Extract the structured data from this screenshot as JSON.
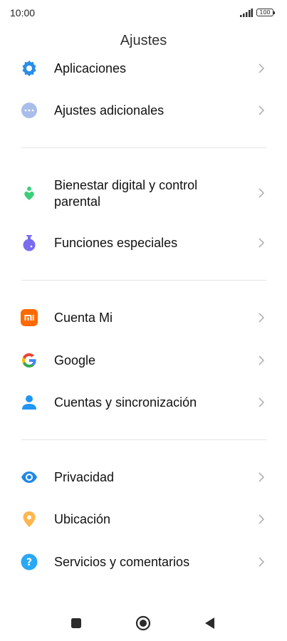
{
  "status_bar": {
    "time": "10:00",
    "battery": "100",
    "signal_icon": "signal-icon"
  },
  "header": {
    "title": "Ajustes"
  },
  "items": [
    {
      "id": "aplicaciones",
      "label": "Aplicaciones",
      "icon": "gear-badge-icon",
      "color": "#2a8ee8"
    },
    {
      "id": "ajustes-adicionales",
      "label": "Ajustes adicionales",
      "icon": "more-dots-icon",
      "color": "#9fb4e6"
    },
    {
      "id": "bienestar-digital",
      "label_line1": "Bienestar digital y control",
      "label_line2": "parental",
      "icon": "wellbeing-icon",
      "color": "#3ccf7a"
    },
    {
      "id": "funciones-especiales",
      "label": "Funciones especiales",
      "icon": "potion-icon",
      "color": "#7a6cf0"
    },
    {
      "id": "cuenta-mi",
      "label": "Cuenta Mi",
      "icon": "mi-logo-icon",
      "color": "#ff6a00"
    },
    {
      "id": "google",
      "label": "Google",
      "icon": "google-g-icon",
      "color": "#4285f4"
    },
    {
      "id": "cuentas-sincronizacion",
      "label": "Cuentas y sincronización",
      "icon": "person-icon",
      "color": "#2196f3"
    },
    {
      "id": "privacidad",
      "label": "Privacidad",
      "icon": "eye-icon",
      "color": "#1e88e5"
    },
    {
      "id": "ubicacion",
      "label": "Ubicación",
      "icon": "location-pin-icon",
      "color": "#ffb74d"
    },
    {
      "id": "servicios-comentarios",
      "label": "Servicios y comentarios",
      "icon": "help-icon",
      "color": "#29a8f5"
    }
  ],
  "navbar": {
    "recents_icon": "square-icon",
    "home_icon": "circle-home-icon",
    "back_icon": "triangle-back-icon"
  }
}
